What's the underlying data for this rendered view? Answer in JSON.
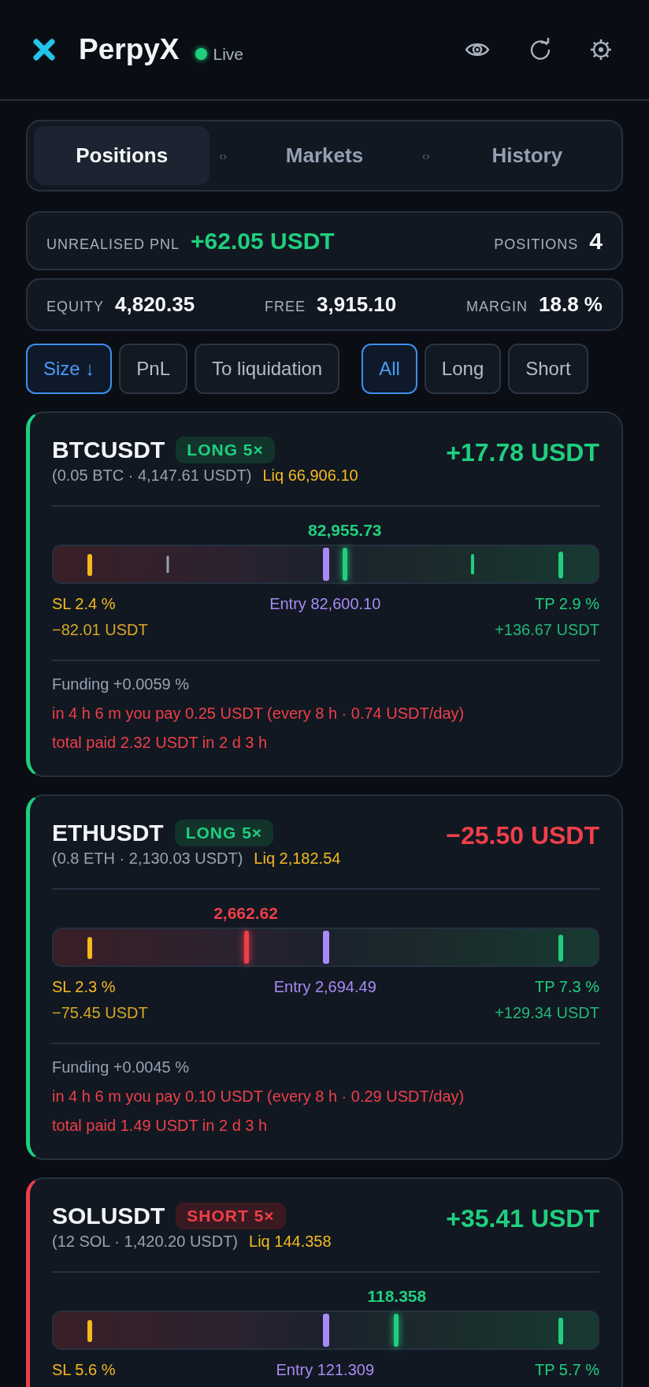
{
  "app": {
    "name": "PerpyX",
    "status": "Live",
    "live": true
  },
  "tabs": [
    {
      "label": "Positions",
      "selected": true
    },
    {
      "label": "Markets",
      "selected": false
    },
    {
      "label": "History",
      "selected": false
    }
  ],
  "tab_separators": [
    "‹›",
    "‹›"
  ],
  "summary": {
    "pnl_label": "UNREALISED PNL",
    "pnl": "+62.05 USDT",
    "pnl_positive": true,
    "positions_label": "POSITIONS",
    "positions": "4"
  },
  "balances": [
    {
      "label": "EQUITY",
      "value": "4,820.35"
    },
    {
      "label": "FREE",
      "value": "3,915.10"
    },
    {
      "label": "MARGIN",
      "value": "18.8 %"
    }
  ],
  "sort_filters": [
    {
      "label": "Size ↓",
      "selected": true
    },
    {
      "label": "PnL",
      "selected": false
    },
    {
      "label": "To liquidation",
      "selected": false
    }
  ],
  "side_filters": [
    {
      "label": "All",
      "selected": true
    },
    {
      "label": "Long",
      "selected": false
    },
    {
      "label": "Short",
      "selected": false
    }
  ],
  "positions": [
    {
      "symbol": "BTCUSDT",
      "long": true,
      "badge": "LONG 5×",
      "pnl": "+17.78 USDT",
      "pnl_positive": true,
      "size": "(0.05 BTC · 4,147.61 USDT)",
      "liq": "Liq 66,906.10",
      "price": {
        "text": "82,955.73",
        "level": 0.535,
        "rising": true
      },
      "markers": [
        {
          "kind": "sl",
          "level": 0.066
        },
        {
          "kind": "tick",
          "level": 0.21
        },
        {
          "kind": "entry",
          "level": 0.5
        },
        {
          "kind": "target",
          "level": 0.77
        },
        {
          "kind": "tp",
          "level": 0.932
        }
      ],
      "sl": "SL 2.4 %",
      "entry": "Entry 82,600.10",
      "tp": "TP 2.9 %",
      "sl_amount": "−82.01 USDT",
      "tp_amount": "+136.67 USDT",
      "funding": "Funding +0.0059 %",
      "funding_next": "in 4 h 6 m you pay 0.25 USDT (every 8 h · 0.74 USDT/day)",
      "funding_total": "total paid 2.32 USDT in 2 d 3 h"
    },
    {
      "symbol": "ETHUSDT",
      "long": true,
      "badge": "LONG 5×",
      "pnl": "−25.50 USDT",
      "pnl_positive": false,
      "size": "(0.8 ETH · 2,130.03 USDT)",
      "liq": "Liq 2,182.54",
      "price": {
        "text": "2,662.62",
        "level": 0.354,
        "rising": false
      },
      "markers": [
        {
          "kind": "sl",
          "level": 0.066
        },
        {
          "kind": "entry",
          "level": 0.5
        },
        {
          "kind": "tp",
          "level": 0.932
        }
      ],
      "sl": "SL 2.3 %",
      "entry": "Entry 2,694.49",
      "tp": "TP 7.3 %",
      "sl_amount": "−75.45 USDT",
      "tp_amount": "+129.34 USDT",
      "funding": "Funding +0.0045 %",
      "funding_next": "in 4 h 6 m you pay 0.10 USDT (every 8 h · 0.29 USDT/day)",
      "funding_total": "total paid 1.49 USDT in 2 d 3 h"
    },
    {
      "symbol": "SOLUSDT",
      "long": false,
      "badge": "SHORT 5×",
      "pnl": "+35.41 USDT",
      "pnl_positive": true,
      "size": "(12 SOL · 1,420.20 USDT)",
      "liq": "Liq 144.358",
      "price": {
        "text": "118.358",
        "level": 0.63,
        "rising": true
      },
      "markers": [
        {
          "kind": "sl",
          "level": 0.066
        },
        {
          "kind": "entry",
          "level": 0.5
        },
        {
          "kind": "tp",
          "level": 0.932
        }
      ],
      "sl": "SL 5.6 %",
      "entry": "Entry 121.309",
      "tp": "TP 5.7 %"
    }
  ]
}
